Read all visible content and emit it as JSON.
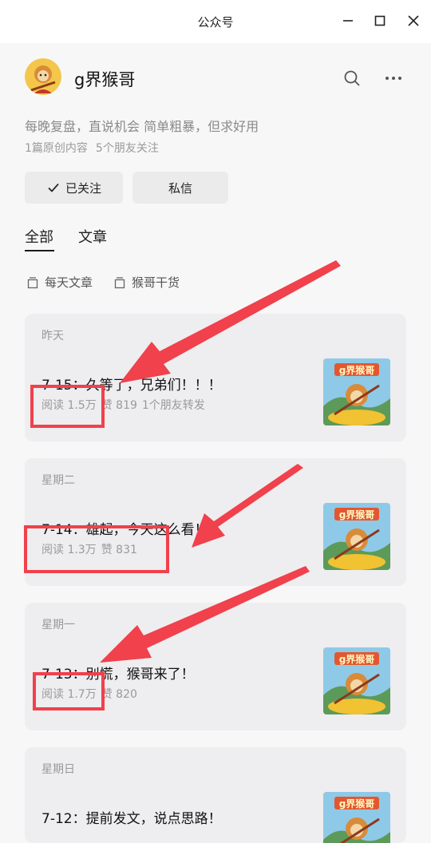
{
  "window": {
    "title": "公众号"
  },
  "account": {
    "name": "g界猴哥",
    "bio": "每晚复盘，直说机会 简单粗暴，但求好用",
    "stats": {
      "original": "1篇原创内容",
      "friends": "5个朋友关注"
    }
  },
  "buttons": {
    "follow": "已关注",
    "message": "私信"
  },
  "tabs": [
    {
      "label": "全部",
      "active": true
    },
    {
      "label": "文章",
      "active": false
    }
  ],
  "collections": [
    "每天文章",
    "猴哥干货"
  ],
  "thumbnail_label": "g界猴哥",
  "articles": [
    {
      "day": "昨天",
      "title": "7-15：久等了，兄弟们！！！",
      "reads": "阅读 1.5万",
      "likes": "赞 819",
      "shares": "1个朋友转发"
    },
    {
      "day": "星期二",
      "title": "7-14：雄起，今天这么看！",
      "reads": "阅读 1.3万",
      "likes": "赞 831"
    },
    {
      "day": "星期一",
      "title": "7-13：别慌，猴哥来了！",
      "reads": "阅读 1.7万",
      "likes": "赞 820"
    },
    {
      "day": "星期日",
      "title": "7-12：提前发文，说点思路！"
    }
  ],
  "annotation_color": "#f0414c"
}
